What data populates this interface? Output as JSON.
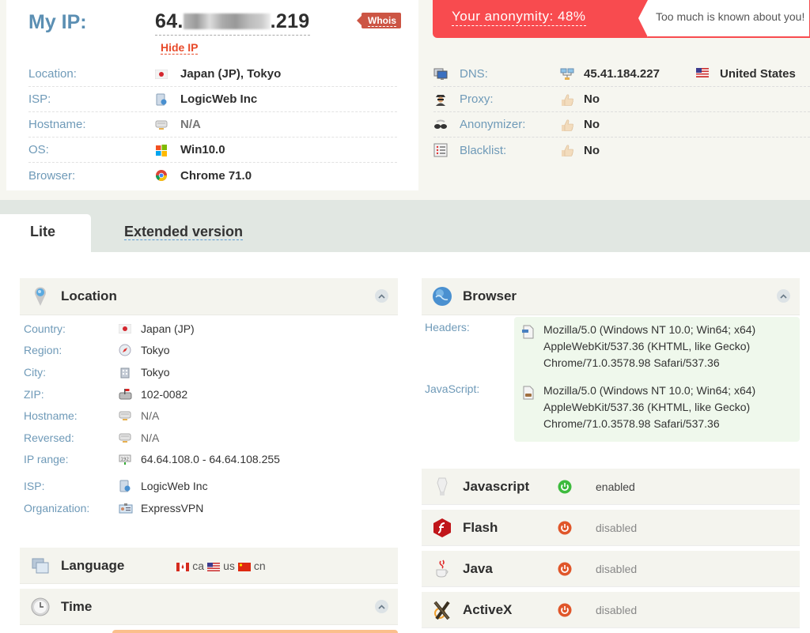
{
  "header": {
    "my_ip_label": "My IP:",
    "ip_prefix": "64.",
    "ip_suffix": ".219",
    "whois_label": "Whois",
    "hide_ip_label": "Hide IP",
    "anonymity_label": "Your anonymity: 48%",
    "anonymity_percent": 48,
    "anonymity_message": "Too much is known about you!"
  },
  "summary": [
    {
      "label": "Location:",
      "icon": "japan-flag-icon",
      "value": "Japan (JP), Tokyo"
    },
    {
      "label": "ISP:",
      "icon": "isp-icon",
      "value": "LogicWeb Inc"
    },
    {
      "label": "Hostname:",
      "icon": "server-icon",
      "value": "N/A"
    },
    {
      "label": "OS:",
      "icon": "windows-icon",
      "value": "Win10.0"
    },
    {
      "label": "Browser:",
      "icon": "chrome-icon",
      "value": "Chrome 71.0"
    }
  ],
  "checks": [
    {
      "label": "DNS:",
      "icon": "dns-icon",
      "value_icon": "network-icon",
      "value": "45.41.184.227",
      "country": "United States"
    },
    {
      "label": "Proxy:",
      "icon": "spy-icon",
      "value_icon": "thumbs-up-icon",
      "value": "No"
    },
    {
      "label": "Anonymizer:",
      "icon": "glasses-icon",
      "value_icon": "thumbs-up-icon",
      "value": "No"
    },
    {
      "label": "Blacklist:",
      "icon": "list-icon",
      "value_icon": "thumbs-up-icon",
      "value": "No"
    }
  ],
  "tabs": {
    "lite": "Lite",
    "extended": "Extended version"
  },
  "location_panel": {
    "title": "Location",
    "rows": [
      {
        "label": "Country:",
        "value": "Japan (JP)"
      },
      {
        "label": "Region:",
        "value": "Tokyo"
      },
      {
        "label": "City:",
        "value": "Tokyo"
      },
      {
        "label": "ZIP:",
        "value": "102-0082"
      },
      {
        "label": "Hostname:",
        "value": "N/A"
      },
      {
        "label": "Reversed:",
        "value": "N/A"
      },
      {
        "label": "IP range:",
        "value": "64.64.108.0 - 64.64.108.255"
      },
      {
        "label": "ISP:",
        "value": "LogicWeb Inc"
      },
      {
        "label": "Organization:",
        "value": "ExpressVPN"
      }
    ]
  },
  "language_panel": {
    "title": "Language",
    "languages": [
      "ca",
      "us",
      "cn"
    ]
  },
  "time_panel": {
    "title": "Time"
  },
  "browser_panel": {
    "title": "Browser",
    "headers_label": "Headers:",
    "javascript_label": "JavaScript:",
    "headers_ua": [
      "Mozilla/5.0 (Windows NT 10.0; Win64; x64)",
      "AppleWebKit/537.36 (KHTML, like Gecko)",
      "Chrome/71.0.3578.98 Safari/537.36"
    ],
    "js_ua": [
      "Mozilla/5.0 (Windows NT 10.0; Win64; x64)",
      "AppleWebKit/537.36 (KHTML, like Gecko)",
      "Chrome/71.0.3578.98 Safari/537.36"
    ]
  },
  "plugins": [
    {
      "name": "Javascript",
      "status": "enabled",
      "enabled": true
    },
    {
      "name": "Flash",
      "status": "disabled",
      "enabled": false
    },
    {
      "name": "Java",
      "status": "disabled",
      "enabled": false
    },
    {
      "name": "ActiveX",
      "status": "disabled",
      "enabled": false
    }
  ],
  "colors": {
    "accent_red": "#f84b4f",
    "label_blue": "#6f9ab8",
    "enabled_green": "#3dbb3d",
    "disabled_orange": "#e0562a"
  }
}
